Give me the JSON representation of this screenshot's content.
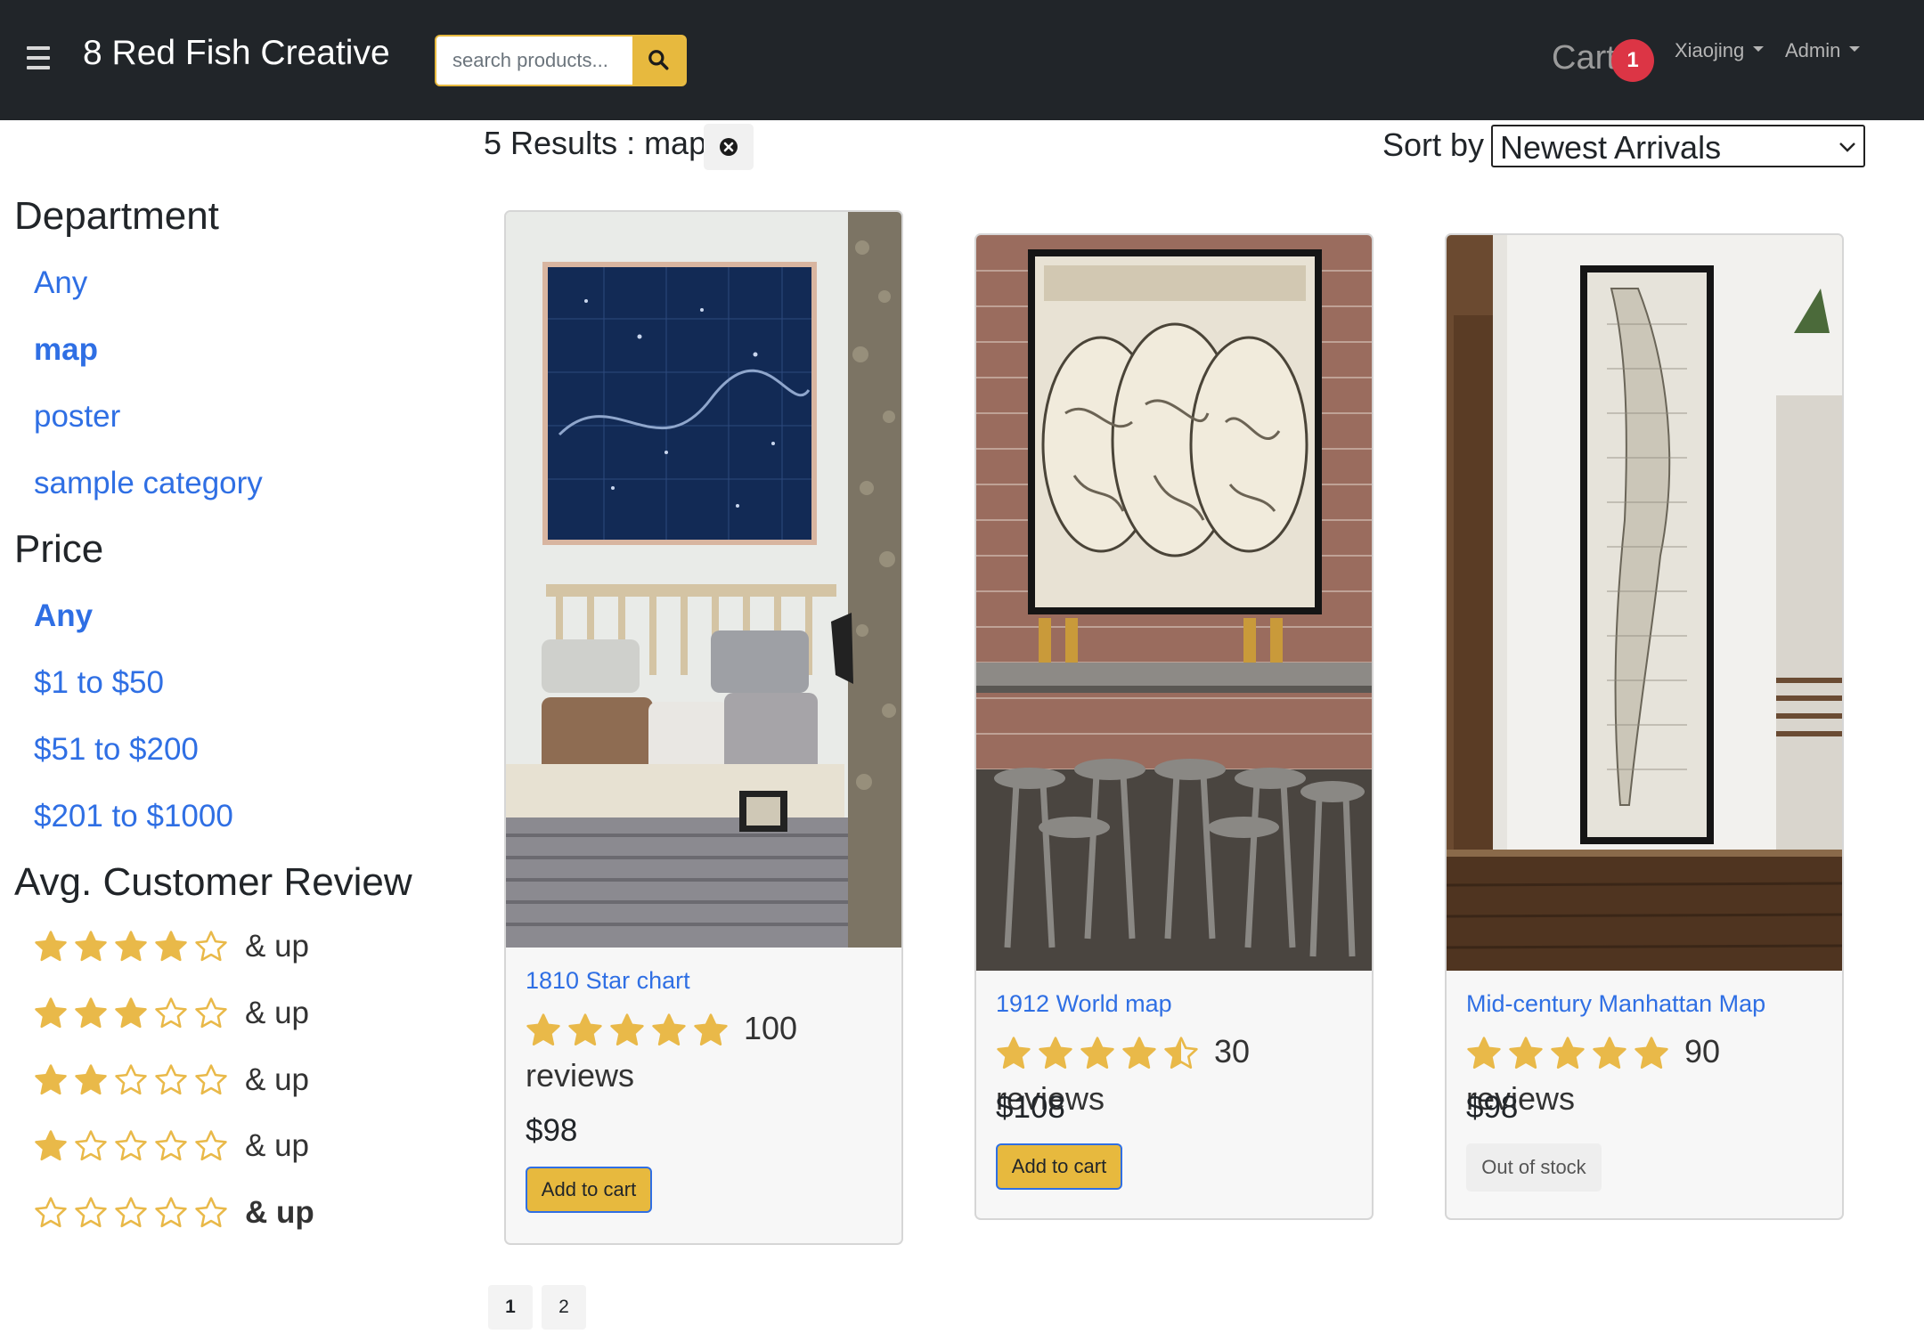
{
  "header": {
    "brand": "8 Red Fish Creative",
    "search_placeholder": "search products...",
    "cart_label": "Cart",
    "cart_count": "1",
    "user_menu": "Xiaojing",
    "admin_menu": "Admin"
  },
  "results": {
    "summary": "5 Results : map",
    "sort_label": "Sort by",
    "sort_value": "Newest Arrivals"
  },
  "sidebar": {
    "department_title": "Department",
    "departments": [
      "Any",
      "map",
      "poster",
      "sample category"
    ],
    "price_title": "Price",
    "prices": [
      "Any",
      "$1 to $50",
      "$51 to $200",
      "$201 to $1000"
    ],
    "review_title": "Avg. Customer Review",
    "review_suffix": "& up",
    "review_filters": [
      4,
      3,
      2,
      1,
      0
    ]
  },
  "products": [
    {
      "title": "1810 Star chart",
      "rating": 5,
      "reviews": "100 reviews",
      "price": "$98",
      "action": "Add to cart",
      "in_stock": true
    },
    {
      "title": "1912 World map",
      "rating": 4.5,
      "reviews": "30 reviews",
      "price": "$108",
      "action": "Add to cart",
      "in_stock": true
    },
    {
      "title": "Mid-century Manhattan Map",
      "rating": 5,
      "reviews": "90 reviews",
      "price": "$98",
      "action": "Out of stock",
      "in_stock": false
    }
  ],
  "pagination": [
    "1",
    "2"
  ],
  "colors": {
    "navbar": "#212529",
    "accent": "#e7b93e",
    "link": "#2f6fe4",
    "badge": "#dc3545",
    "star": "#e9b949"
  },
  "icons": {
    "menu": "hamburger-icon",
    "search": "search-icon",
    "clear": "close-circle-icon",
    "select": "chevron-down-icon",
    "rating": "star-icon"
  }
}
